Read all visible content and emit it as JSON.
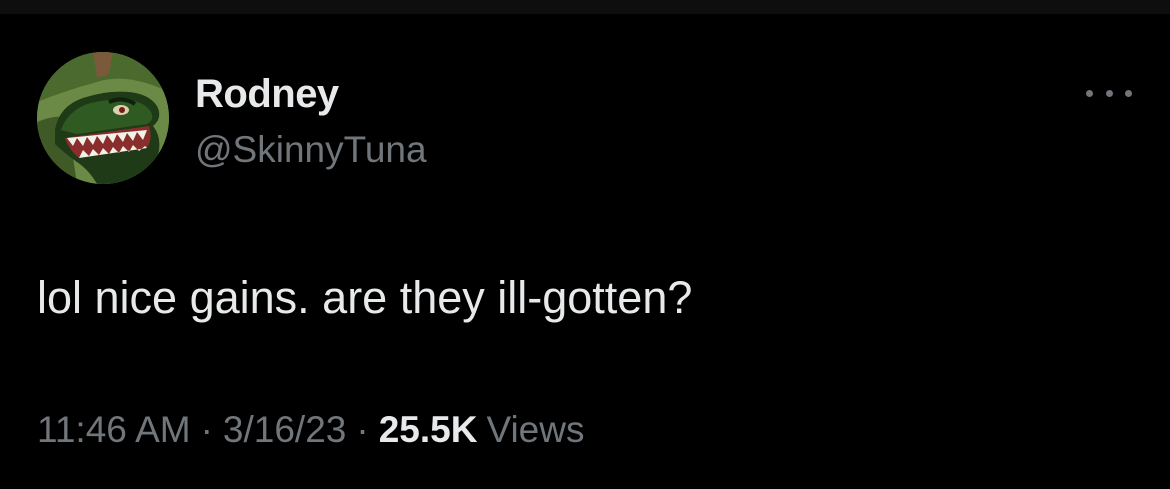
{
  "author": {
    "display_name": "Rodney",
    "handle": "@SkinnyTuna",
    "avatar_icon": "dinosaur-avatar-icon"
  },
  "tweet": {
    "text": "lol nice gains. are they ill-gotten?"
  },
  "meta": {
    "time": "11:46 AM",
    "separator": "·",
    "date": "3/16/23",
    "views_count": "25.5K",
    "views_label": "Views"
  },
  "icons": {
    "more": "more-horizontal-icon"
  },
  "colors": {
    "background": "#000000",
    "primary_text": "#e7e9ea",
    "secondary_text": "#71767b"
  }
}
